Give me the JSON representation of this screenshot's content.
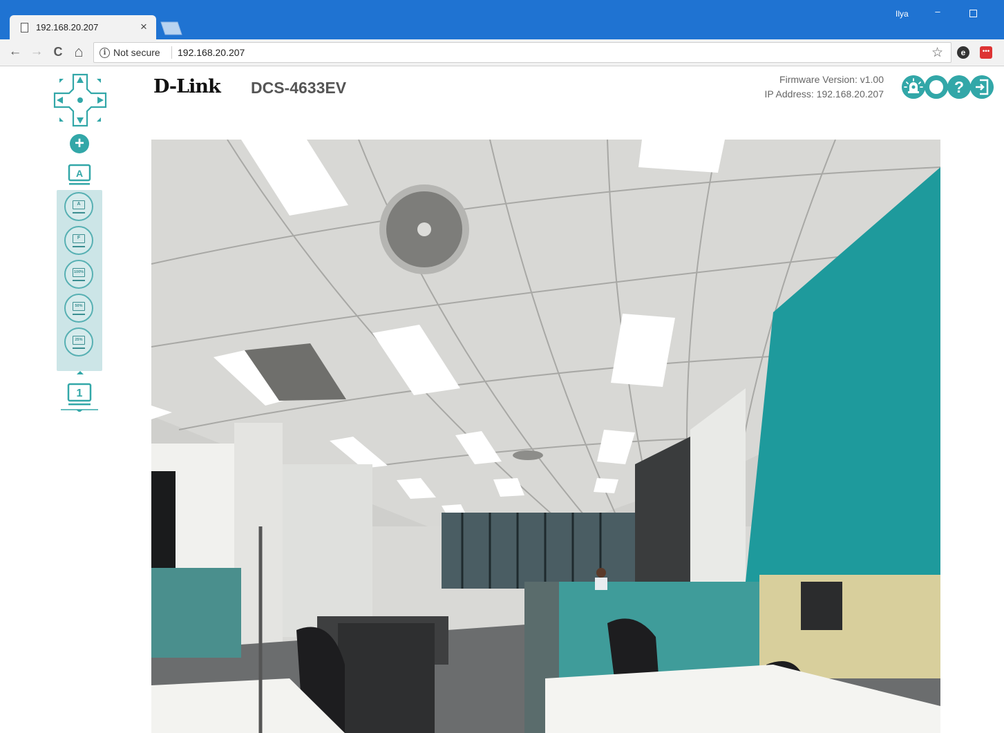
{
  "browser": {
    "tab_title": "192.168.20.207",
    "tab_close": "×",
    "user": "Ilya",
    "minimize": "–",
    "nav": {
      "back": "←",
      "forward": "→",
      "reload": "C",
      "home": "⌂"
    },
    "info_glyph": "i",
    "security_label": "Not secure",
    "url": "192.168.20.207",
    "star": "☆",
    "extensions": [
      {
        "name": "ghostery",
        "glyph": "e"
      },
      {
        "name": "lastpass",
        "glyph": "•••"
      }
    ]
  },
  "header": {
    "brand": "D-Link",
    "model": "DCS-4633EV",
    "firmware": "Firmware Version: v1.00",
    "ip": "IP Address: 192.168.20.207",
    "icons": [
      "alarm-icon",
      "snapshot-icon",
      "help-icon",
      "logout-icon"
    ],
    "help_glyph": "?"
  },
  "sidebar": {
    "zoom_in": "+",
    "main_mode": "A",
    "display_modes": [
      {
        "label": "A",
        "name": "display-auto-button"
      },
      {
        "label": "F",
        "name": "display-fit-button"
      },
      {
        "label": "100%",
        "name": "display-100-button"
      },
      {
        "label": "50%",
        "name": "display-50-button"
      },
      {
        "label": "25%",
        "name": "display-25-button"
      }
    ],
    "channel": "1"
  },
  "colors": {
    "accent": "#32a7a8",
    "chrome_blue": "#1f73d2",
    "panel_bg": "#cce5e7"
  }
}
